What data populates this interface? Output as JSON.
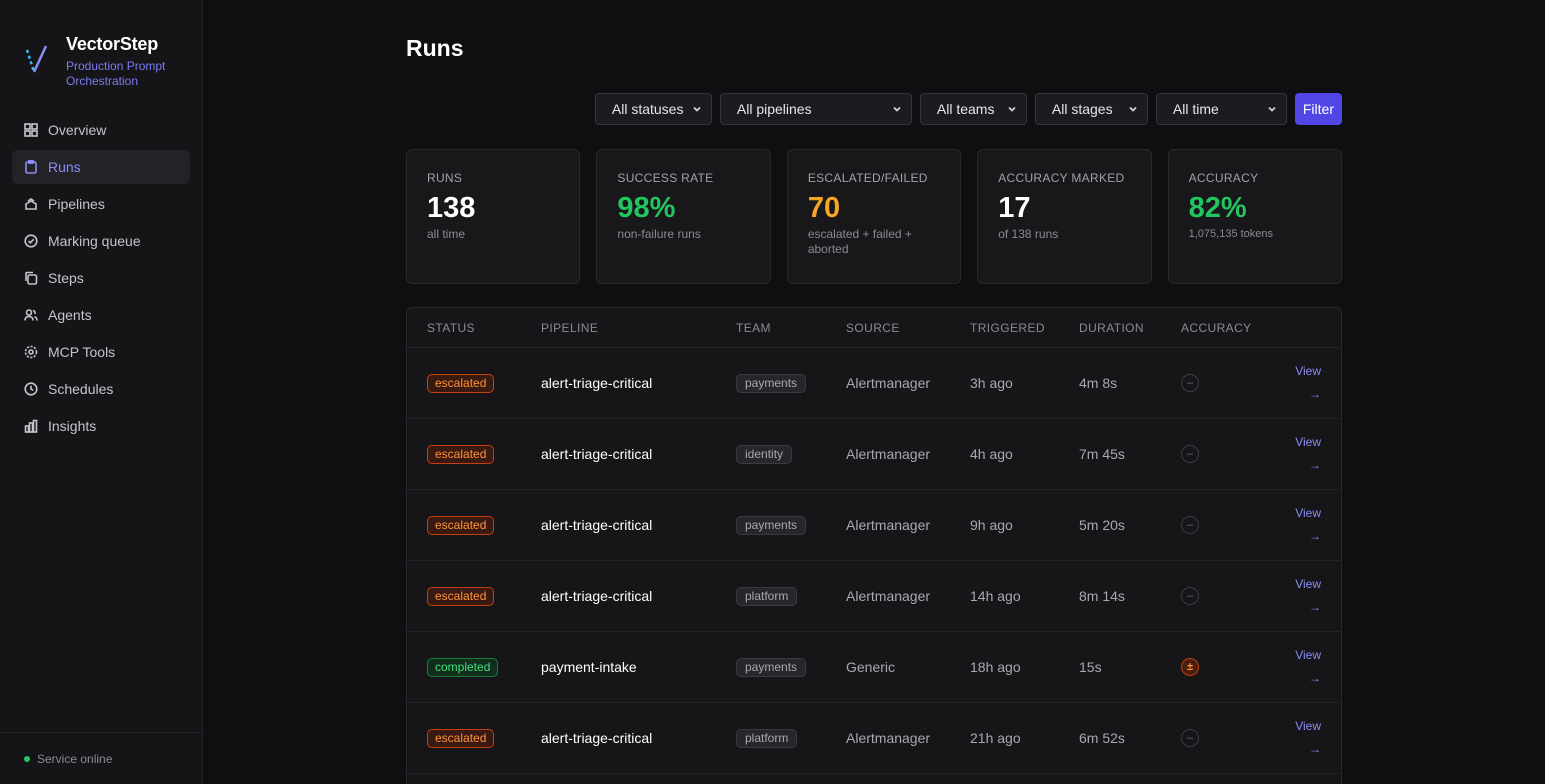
{
  "brand": {
    "name": "VectorStep",
    "tagline": "Production Prompt Orchestration"
  },
  "nav": [
    {
      "label": "Overview",
      "icon": "grid-icon",
      "active": false
    },
    {
      "label": "Runs",
      "icon": "clipboard-icon",
      "active": true
    },
    {
      "label": "Pipelines",
      "icon": "layers-icon",
      "active": false
    },
    {
      "label": "Marking queue",
      "icon": "check-circle-icon",
      "active": false
    },
    {
      "label": "Steps",
      "icon": "copy-icon",
      "active": false
    },
    {
      "label": "Agents",
      "icon": "users-icon",
      "active": false
    },
    {
      "label": "MCP Tools",
      "icon": "gear-icon",
      "active": false
    },
    {
      "label": "Schedules",
      "icon": "clock-icon",
      "active": false
    },
    {
      "label": "Insights",
      "icon": "bar-chart-icon",
      "active": false
    }
  ],
  "footer": {
    "status": "Service online"
  },
  "page": {
    "title": "Runs"
  },
  "filters": {
    "status": "All statuses",
    "pipeline": "All pipelines",
    "team": "All teams",
    "stage": "All stages",
    "time": "All time",
    "button": "Filter"
  },
  "stats": [
    {
      "label": "Runs",
      "value": "138",
      "sub": "all time"
    },
    {
      "label": "Success rate",
      "value": "98%",
      "sub": "non-failure runs"
    },
    {
      "label": "Escalated/Failed",
      "value": "70",
      "sub": "escalated + failed + aborted"
    },
    {
      "label": "Accuracy marked",
      "value": "17",
      "sub": "of 138 runs"
    },
    {
      "label": "Accuracy",
      "value": "82%",
      "sub": "1,075,135 tokens"
    }
  ],
  "table": {
    "headers": [
      "Status",
      "Pipeline",
      "Team",
      "Source",
      "Triggered",
      "Duration",
      "Accuracy"
    ],
    "view_label": "View",
    "view_arrow": "→",
    "rows": [
      {
        "status": "escalated",
        "pipeline": "alert-triage-critical",
        "team": "payments",
        "source": "Alertmanager",
        "triggered": "3h ago",
        "duration": "4m 8s",
        "accuracy": "–"
      },
      {
        "status": "escalated",
        "pipeline": "alert-triage-critical",
        "team": "identity",
        "source": "Alertmanager",
        "triggered": "4h ago",
        "duration": "7m 45s",
        "accuracy": "–"
      },
      {
        "status": "escalated",
        "pipeline": "alert-triage-critical",
        "team": "payments",
        "source": "Alertmanager",
        "triggered": "9h ago",
        "duration": "5m 20s",
        "accuracy": "–"
      },
      {
        "status": "escalated",
        "pipeline": "alert-triage-critical",
        "team": "platform",
        "source": "Alertmanager",
        "triggered": "14h ago",
        "duration": "8m 14s",
        "accuracy": "–"
      },
      {
        "status": "completed",
        "pipeline": "payment-intake",
        "team": "payments",
        "source": "Generic",
        "triggered": "18h ago",
        "duration": "15s",
        "accuracy": "±"
      },
      {
        "status": "escalated",
        "pipeline": "alert-triage-critical",
        "team": "platform",
        "source": "Alertmanager",
        "triggered": "21h ago",
        "duration": "6m 52s",
        "accuracy": "–"
      }
    ]
  }
}
